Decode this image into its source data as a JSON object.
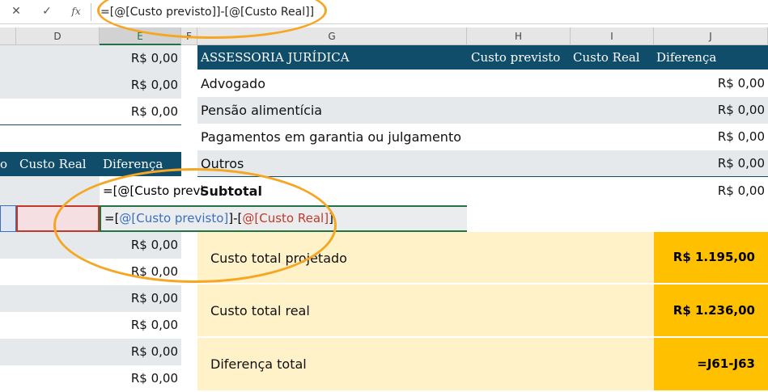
{
  "formula_bar": {
    "cancel_icon": "✕",
    "enter_icon": "✓",
    "fx_label": "fx",
    "formula": "=[@[Custo previsto]]-[@[Custo Real]]"
  },
  "columns": [
    "D",
    "E",
    "F",
    "G",
    "H",
    "I",
    "J"
  ],
  "left_values_top": [
    "R$ 0,00",
    "R$ 0,00",
    "R$ 0,00"
  ],
  "left_table": {
    "header_cut": "o",
    "header_real": "Custo Real",
    "header_diff": "Diferença",
    "formula_preview": "=[@[Custo previ",
    "edit_prefix": "=[",
    "edit_ref1": "@[Custo previsto]",
    "edit_mid": "]-[",
    "edit_ref2": "@[Custo Real]",
    "edit_suffix": "]",
    "values": [
      "R$ 0,00",
      "R$ 0,00",
      "R$ 0,00",
      "R$ 0,00",
      "R$ 0,00",
      "R$ 0,00"
    ]
  },
  "right_table": {
    "title": "ASSESSORIA JURÍDICA",
    "h_prev": "Custo previsto",
    "h_real": "Custo Real",
    "h_diff": "Diferença",
    "rows": [
      {
        "label": "Advogado",
        "value": "R$ 0,00"
      },
      {
        "label": "Pensão alimentícia",
        "value": "R$ 0,00"
      },
      {
        "label": "Pagamentos em garantia ou julgamento",
        "value": "R$ 0,00"
      },
      {
        "label": "Outros",
        "value": "R$ 0,00"
      }
    ],
    "subtotal_label": "Subtotal",
    "subtotal_value": "R$ 0,00"
  },
  "summary": [
    {
      "label": "Custo total projetado",
      "value": "R$ 1.195,00"
    },
    {
      "label": "Custo total real",
      "value": "R$ 1.236,00"
    },
    {
      "label": "Diferença total",
      "value": "=J61-J63"
    }
  ],
  "colors": {
    "header_blue": "#0f4d6b",
    "summary_bg": "#fff1c8",
    "summary_value_bg": "#ffc000",
    "highlight_ring": "#f5a623",
    "ref_blue": "#3a6fc4",
    "ref_red": "#c0392b"
  }
}
